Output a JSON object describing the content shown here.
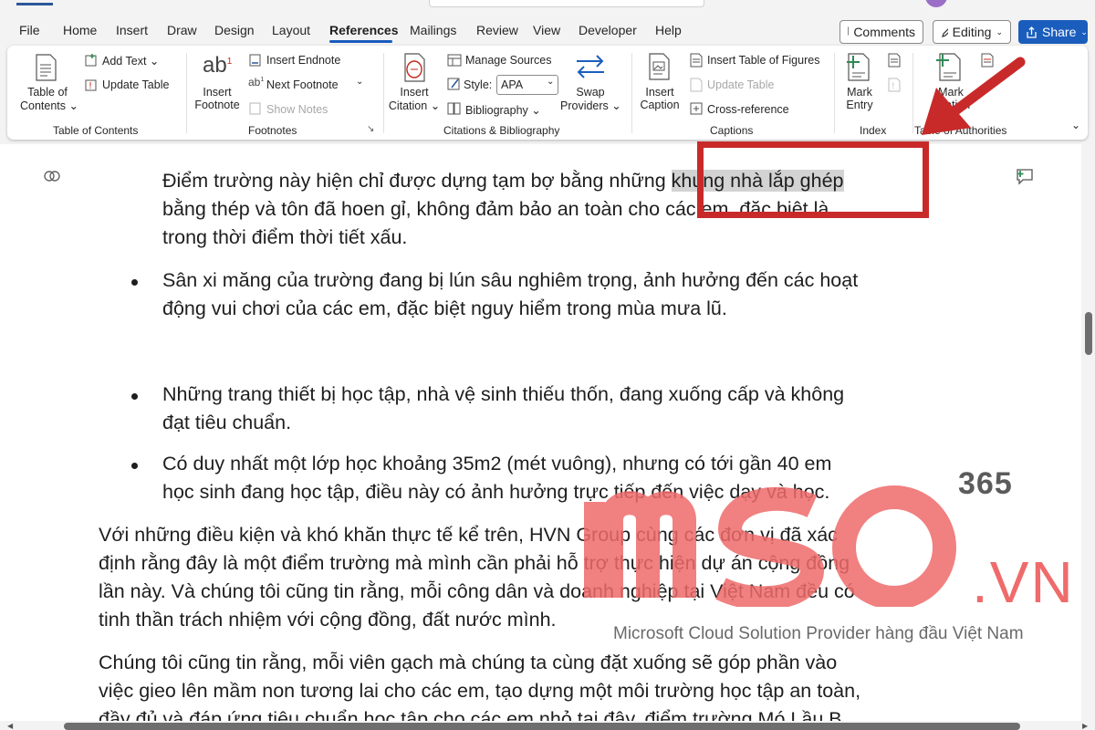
{
  "menu": {
    "tabs": [
      "File",
      "Home",
      "Insert",
      "Draw",
      "Design",
      "Layout",
      "References",
      "Mailings",
      "Review",
      "View",
      "Developer",
      "Help"
    ],
    "active_tab": "References",
    "comments_label": "Comments",
    "editing_label": "Editing",
    "share_label": "Share"
  },
  "ribbon": {
    "toc": {
      "button_label_1": "Table of",
      "button_label_2": "Contents",
      "add_text": "Add Text",
      "update_table": "Update Table",
      "group_label": "Table of Contents"
    },
    "footnotes": {
      "insert_footnote_1": "Insert",
      "insert_footnote_2": "Footnote",
      "insert_endnote": "Insert Endnote",
      "next_footnote": "Next Footnote",
      "show_notes": "Show Notes",
      "group_label": "Footnotes"
    },
    "citations": {
      "insert_citation_1": "Insert",
      "insert_citation_2": "Citation",
      "manage_sources": "Manage Sources",
      "style_label": "Style:",
      "style_value": "APA",
      "bibliography": "Bibliography",
      "swap_providers_1": "Swap",
      "swap_providers_2": "Providers",
      "group_label": "Citations & Bibliography"
    },
    "captions": {
      "insert_caption_1": "Insert",
      "insert_caption_2": "Caption",
      "insert_table_of_figures": "Insert Table of Figures",
      "update_table": "Update Table",
      "cross_reference": "Cross-reference",
      "group_label": "Captions"
    },
    "index": {
      "mark_entry_1": "Mark",
      "mark_entry_2": "Entry",
      "group_label": "Index"
    },
    "authorities": {
      "mark_citation_1": "Mark",
      "mark_citation_2": "Citation",
      "group_label": "Table of Authorities"
    }
  },
  "document": {
    "p1_line1_before": "Điểm trường này hiện chỉ được dựng tạm bợ bằng những ",
    "p1_line1_highlight": "khung nhà lắp ghép",
    "p1_line2": "bằng thép và tôn đã hoen gỉ, không đảm bảo an toàn cho các em, đặc biệt là",
    "p1_line3": "trong thời điểm thời tiết xấu.",
    "b1_line1": "Sân xi măng của trường đang bị lún sâu nghiêm trọng, ảnh hưởng đến các hoạt",
    "b1_line2": "động vui chơi của các em, đặc biệt nguy hiểm trong mùa mưa lũ.",
    "b2_line1": "Những trang thiết bị học tập, nhà vệ sinh thiếu thốn, đang xuống cấp và không",
    "b2_line2": "đạt tiêu chuẩn.",
    "b3_line1": "Có duy nhất một lớp học khoảng 35m2 (mét vuông), nhưng có tới gần 40 em",
    "b3_line2": "học sinh đang học tập, điều này có ảnh hưởng trực tiếp đến việc dạy và học.",
    "p2_line1": "Với những điều kiện và khó khăn thực tế kể trên, HVN Group cùng các đơn vị đã xác",
    "p2_line2": "định rằng đây là một điểm trường mà mình cần phải hỗ trợ thực hiện dự án cộng đồng",
    "p2_line3": "lần này. Và chúng tôi cũng tin rằng, mỗi công dân và doanh nghiệp tại Việt Nam đều có",
    "p2_line4": "tinh thần trách nhiệm với cộng đồng, đất nước mình.",
    "p3_line1": "Chúng tôi cũng tin rằng, mỗi viên gạch mà chúng ta cùng đặt xuống sẽ góp phần vào",
    "p3_line2": "việc gieo lên mầm non tương lai cho các em, tạo dựng một môi trường học tập an toàn,",
    "p3_line3": "đầy đủ và đáp ứng tiêu chuẩn học tập cho các em nhỏ tại đây, điểm trường Mó Lầu B"
  },
  "watermark": {
    "number": "365",
    "domain": ".VN",
    "tagline": "Microsoft Cloud Solution Provider hàng đầu Việt Nam",
    "logo_text": "mso"
  },
  "colors": {
    "accent": "#185abd",
    "annotation": "#c82a2a",
    "watermark": "#ef6b6b"
  }
}
